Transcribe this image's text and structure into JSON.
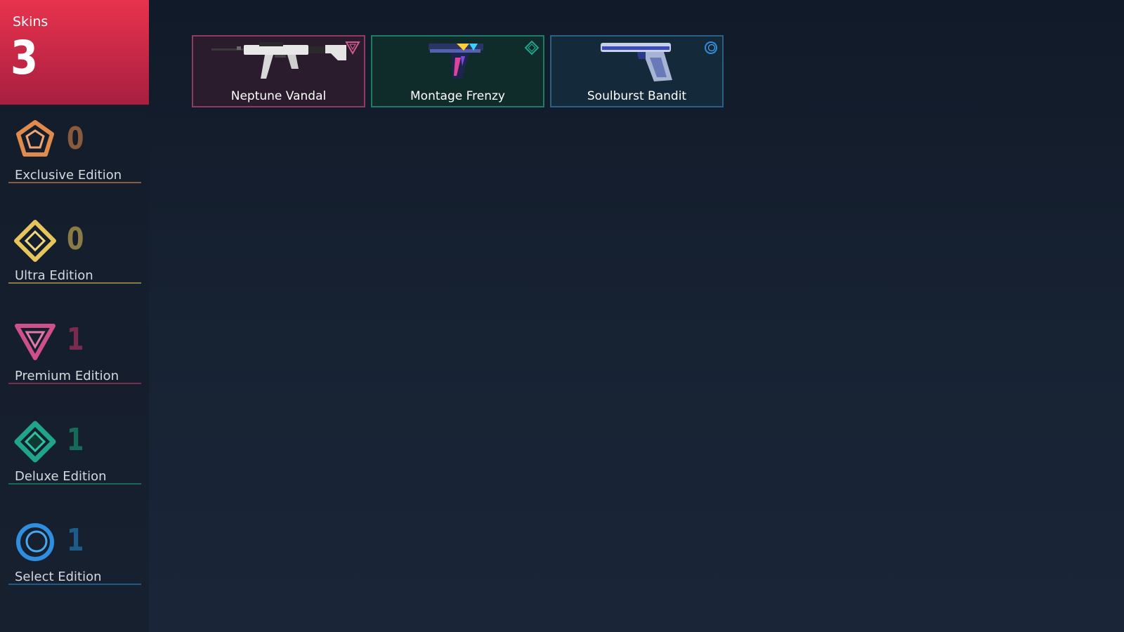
{
  "summary": {
    "label": "Skins",
    "count": "3"
  },
  "tiers": [
    {
      "name": "Exclusive Edition",
      "count": "0",
      "icon": "exclusive-edition-icon",
      "color": "#e08a4c",
      "count_color": "#8a5a3c",
      "line_color": "#8a5a3c"
    },
    {
      "name": "Ultra Edition",
      "count": "0",
      "icon": "ultra-edition-icon",
      "color": "#e6c55a",
      "count_color": "#8a7a45",
      "line_color": "#8a7a45"
    },
    {
      "name": "Premium Edition",
      "count": "1",
      "icon": "premium-edition-icon",
      "color": "#cf4f8b",
      "count_color": "#7a2c4f",
      "line_color": "#7a2c4f"
    },
    {
      "name": "Deluxe Edition",
      "count": "1",
      "icon": "deluxe-edition-icon",
      "color": "#1fa58a",
      "count_color": "#166a5a",
      "line_color": "#166a5a"
    },
    {
      "name": "Select Edition",
      "count": "1",
      "icon": "select-edition-icon",
      "color": "#2e8fe0",
      "count_color": "#1e5a8a",
      "line_color": "#1e5a8a"
    }
  ],
  "skins": [
    {
      "name": "Neptune Vandal",
      "tier": "Premium Edition",
      "weapon": "vandal-rifle-image",
      "bg": "#2a1c2c",
      "border": "#8e3a63",
      "badge_icon": "premium-edition-icon",
      "badge_color": "#d05a8f"
    },
    {
      "name": "Montage Frenzy",
      "tier": "Deluxe Edition",
      "weapon": "frenzy-pistol-image",
      "bg": "#0f2c2b",
      "border": "#1f7a68",
      "badge_icon": "deluxe-edition-icon",
      "badge_color": "#1fa58a"
    },
    {
      "name": "Soulburst Bandit",
      "tier": "Select Edition",
      "weapon": "bandit-pistol-image",
      "bg": "#14293a",
      "border": "#2a5f86",
      "badge_icon": "select-edition-icon",
      "badge_color": "#2e8fe0"
    }
  ]
}
